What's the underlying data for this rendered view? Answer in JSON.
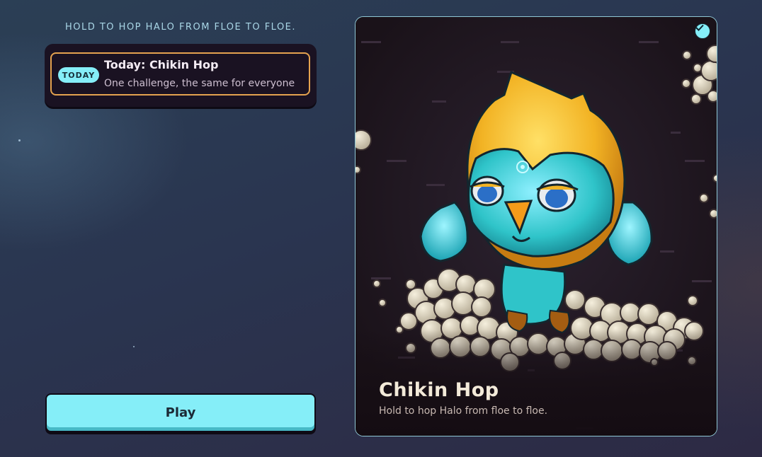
{
  "tagline": "HOLD TO HOP HALO FROM FLOE TO FLOE.",
  "today": {
    "badge": "TODAY",
    "title": "Today: Chikin Hop",
    "subtitle": "One challenge, the same for everyone"
  },
  "play_label": "Play",
  "game": {
    "title": "Chikin Hop",
    "description": "Hold to hop Halo from floe to floe.",
    "selected_icon": "check-icon"
  },
  "colors": {
    "accent": "#85eef8",
    "today_border": "#e4a24f",
    "card_border": "#8fc7d4"
  }
}
